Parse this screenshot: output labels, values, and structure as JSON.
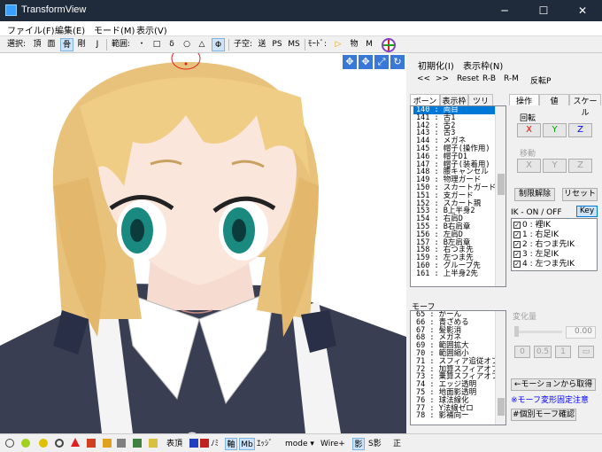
{
  "window": {
    "title": "TransformView",
    "minimize": "─",
    "maximize": "☐",
    "close": "✕"
  },
  "menu": [
    "ファイル(F)",
    "編集(E)",
    "モード(M)",
    "表示(V)"
  ],
  "toolbar": {
    "select_label": "選択:",
    "select_items": [
      "頂",
      "面",
      "骨",
      "剛",
      "J"
    ],
    "range_label": "範囲:",
    "range_items": [
      "・",
      "□",
      "δ",
      "○",
      "△",
      "Φ"
    ],
    "sub_label": "子空:",
    "sub_items": [
      "送",
      "PS",
      "MS"
    ],
    "mode_label": "ﾓｰﾄﾞ:",
    "mode_items": [
      "▷",
      "物",
      "M"
    ]
  },
  "right_top": {
    "init": "初期化(I)",
    "display": "表示枠(N)",
    "buttons": [
      "<<",
      ">>",
      "Reset",
      "R-B",
      "R-M",
      "反転P"
    ]
  },
  "bone_tabs": [
    "ボーン",
    "表示枠",
    "ツリー"
  ],
  "bones": [
    "140 : 両目",
    "141 : 舌1",
    "142 : 舌2",
    "143 : 舌3",
    "144 : メガネ",
    "145 : 帽子(操作用)",
    "146 : 帽子D1",
    "147 : 帽子(装着用)",
    "148 : 腰キャンセル",
    "149 : 物理ガード",
    "150 : スカートガード",
    "151 : 支ガード",
    "152 : スカート親",
    "153 : B上半身2",
    "154 : 右肩D",
    "155 : B右肩章",
    "156 : 左肩D",
    "157 : B左肩章",
    "158 : 右つま先",
    "159 : 左つま先",
    "160 : グルーブ先",
    "161 : 上半身2先"
  ],
  "op_tabs": [
    "操作",
    "値",
    "スケール"
  ],
  "rotate": {
    "label": "回転",
    "x": "X",
    "y": "Y",
    "z": "Z"
  },
  "move": {
    "label": "移動",
    "x": "X",
    "y": "Y",
    "z": "Z"
  },
  "limit_release": "制限解除",
  "reset": "リセット",
  "ik": {
    "label": "IK - ON / OFF",
    "key": "Key",
    "items": [
      "0 : 裡IK",
      "1 : 右足IK",
      "2 : 右つま先IK",
      "3 : 左足IK",
      "4 : 左つま先IK"
    ]
  },
  "morph": {
    "label": "モーフ",
    "items": [
      "65 : がーん",
      "66 : 青ざめる",
      "67 : 髪影消",
      "68 : メガネ",
      "69 : 範囲拡大",
      "70 : 範囲縮小",
      "71 : スフィア追従オフ",
      "72 : 加算スフィアオフ",
      "73 : 乗算スフィアオフ",
      "74 : エッジ透明",
      "75 : 地面影透明",
      "76 : 球法線化",
      "77 : Y法線ゼロ",
      "78 : 影補向ー"
    ]
  },
  "change": {
    "label": "変化量",
    "value": "0.00",
    "b0": "0",
    "b05": "0.5",
    "b1": "1"
  },
  "motion_get": "←モーションから取得",
  "warning": "※モーフ変形固定注意",
  "morph_confirm": "#個別モーフ確認",
  "statusbar": {
    "surface": "表頂",
    "nomi": "ﾉﾐ",
    "axis": "軸",
    "mb": "Mb",
    "edge": "ｴｯｼﾞ",
    "mode": "mode ▾",
    "wire": "Wire+",
    "shadow": "影",
    "sshadow": "S影",
    "right": "正"
  },
  "colors": {
    "titlebar": "#1f2b3a",
    "selection": "#0078d7",
    "red": "#ff0000",
    "green": "#00a000",
    "blue": "#0000ff"
  }
}
